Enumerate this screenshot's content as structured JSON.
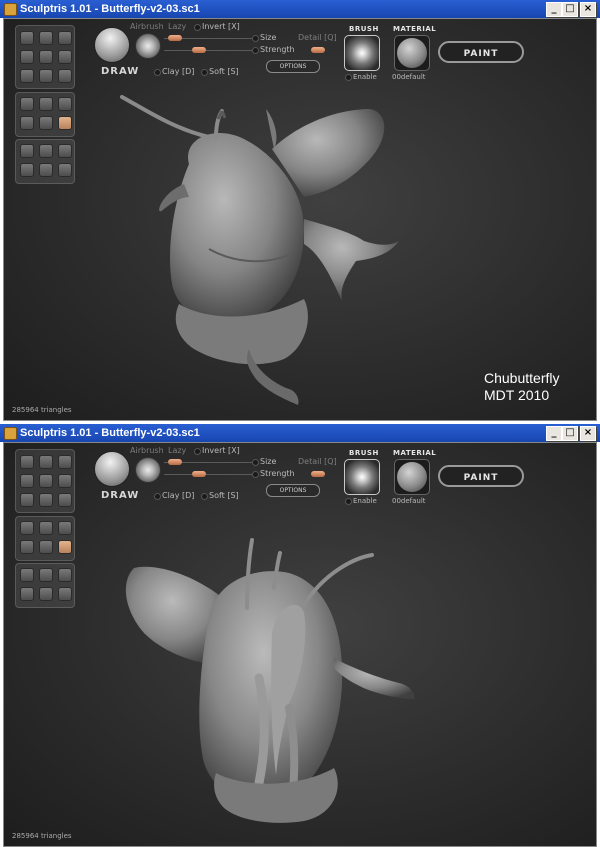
{
  "window_title": "Sculptris 1.01 - Butterfly-v2-03.sc1",
  "window_controls": {
    "minimize": "_",
    "maximize": "□",
    "close": "×"
  },
  "toolbar": {
    "draw_label": "DRAW",
    "airbrush_label": "Airbrush",
    "lazy_label": "Lazy",
    "invert_label": "Invert [X]",
    "size_label": "Size",
    "detail_label": "Detail [Q]",
    "strength_label": "Strength",
    "options_label": "OPTIONS",
    "clay_label": "Clay [D]",
    "soft_label": "Soft [S]",
    "brush_header": "BRUSH",
    "brush_enable_label": "Enable",
    "material_header": "MATERIAL",
    "material_name": "00default",
    "paint_label": "PAINT"
  },
  "status": {
    "triangles": "285964 triangles"
  },
  "caption": {
    "line1": "Chubutterfly",
    "line2": "MDT 2010"
  },
  "colors": {
    "titlebar": "#1f52c4",
    "viewport_bg": "#2e2e2e",
    "accent_knob": "#d88a62",
    "model": "#8c8c8c"
  }
}
